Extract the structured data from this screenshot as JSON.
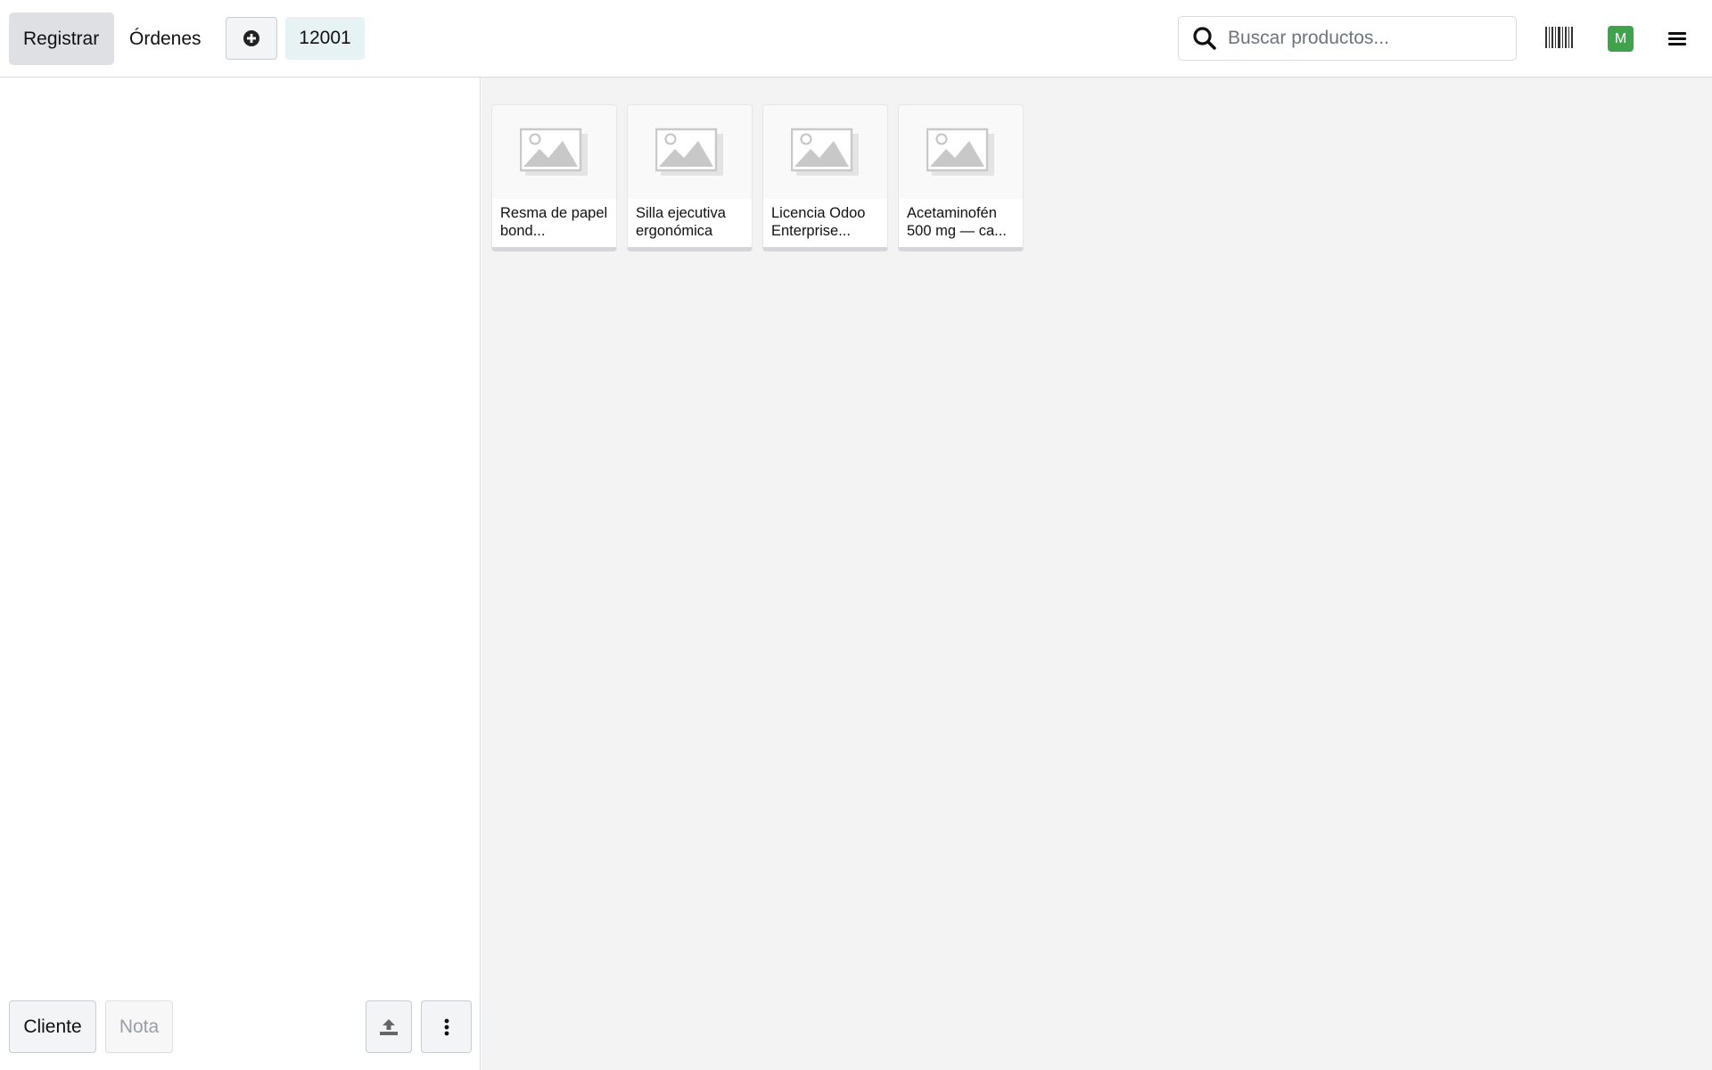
{
  "header": {
    "register_label": "Registrar",
    "orders_label": "Órdenes",
    "order_tab": "12001",
    "search_placeholder": "Buscar productos...",
    "avatar_initial": "M"
  },
  "footer": {
    "customer_label": "Cliente",
    "note_label": "Nota"
  },
  "products": [
    {
      "name": "Resma de papel bond..."
    },
    {
      "name": "Silla ejecutiva ergonómica"
    },
    {
      "name": "Licencia Odoo Enterprise..."
    },
    {
      "name": "Acetaminofén 500 mg — ca..."
    }
  ],
  "colors": {
    "avatar_bg": "#3fa34d",
    "active_tab_bg": "#dee0e3",
    "order_tab_bg": "#e6f2f3",
    "product_area_bg": "#f3f3f3"
  },
  "icons": [
    "plus-circle-icon",
    "search-icon",
    "barcode-icon",
    "hamburger-menu-icon",
    "upload-icon",
    "vertical-dots-icon",
    "image-placeholder-icon"
  ]
}
